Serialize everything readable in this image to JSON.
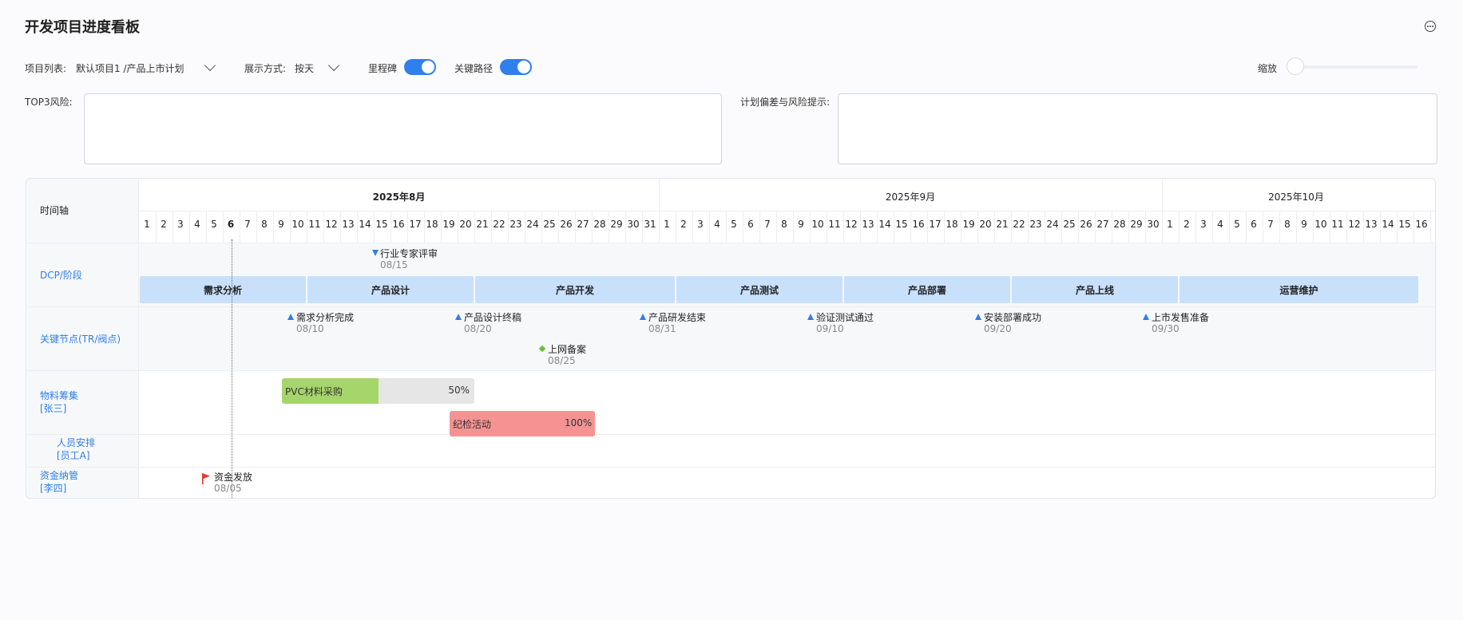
{
  "title": "开发项目进度看板",
  "toolbar": {
    "project_label": "项目列表:",
    "project_value": "默认项目1 /产品上市计划",
    "display_label": "展示方式:",
    "display_value": "按天",
    "milestone_label": "里程碑",
    "milestone_on": true,
    "critical_path_label": "关键路径",
    "critical_path_on": true,
    "zoom_label": "缩放",
    "zoom_level": 0
  },
  "risk": {
    "top3_label": "TOP3风险:",
    "top3_value": "",
    "deviation_label": "计划偏差与风险提示:",
    "deviation_value": ""
  },
  "gantt": {
    "axis_label": "时间轴",
    "months": [
      {
        "label": "2025年8月",
        "days": 31,
        "bold": true
      },
      {
        "label": "2025年9月",
        "days": 30,
        "bold": false
      },
      {
        "label": "2025年10月",
        "days": 16,
        "bold": false
      }
    ],
    "today_day": 6,
    "rows": {
      "dcp": "DCP/阶段",
      "key_nodes": "关键节点(TR/阀点)",
      "materials": [
        "物料筹集",
        "[张三]"
      ],
      "staff": [
        "人员安排",
        "[员工A]"
      ],
      "funds": [
        "资金纳管",
        "[李四]"
      ]
    },
    "review": {
      "title": "行业专家评审",
      "date": "08/15"
    },
    "phases": [
      "需求分析",
      "产品设计",
      "产品开发",
      "产品测试",
      "产品部署",
      "产品上线",
      "运营维护"
    ],
    "milestones": [
      {
        "title": "需求分析完成",
        "date": "08/10"
      },
      {
        "title": "产品设计终稿",
        "date": "08/20"
      },
      {
        "title": "产品研发结束",
        "date": "08/31"
      },
      {
        "title": "验证测试通过",
        "date": "09/10"
      },
      {
        "title": "安装部署成功",
        "date": "09/20"
      },
      {
        "title": "上市发售准备",
        "date": "09/30"
      }
    ],
    "filing": {
      "title": "上网备案",
      "date": "08/25"
    },
    "tasks": [
      {
        "name": "PVC材料采购",
        "percent": "50%",
        "progress": 0.5,
        "color": "#a6d66b",
        "track": "#e6e6e6"
      },
      {
        "name": "纪检活动",
        "percent": "100%",
        "progress": 1.0,
        "color": "#f59393",
        "track": "#f59393"
      }
    ],
    "fund_event": {
      "title": "资金发放",
      "date": "08/05",
      "flag_color": "#e8362c"
    }
  },
  "colors": {
    "accent": "#2f80ed",
    "phase_bg": "#c9e0fb",
    "label_blue": "#2f7fe6"
  }
}
